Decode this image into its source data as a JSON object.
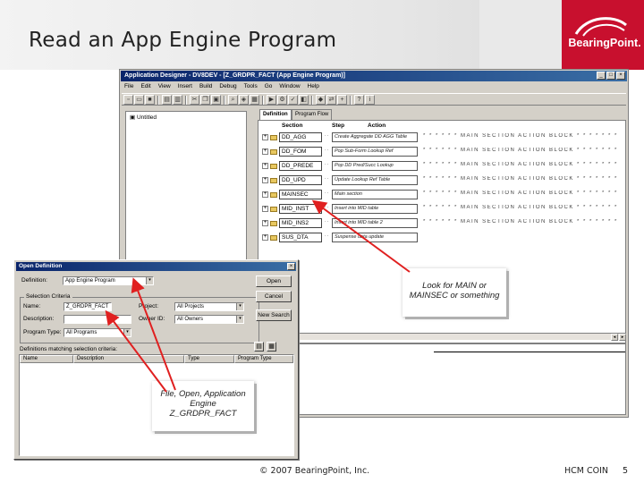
{
  "slide": {
    "title": "Read an App Engine Program",
    "logo_text": "BearingPoint.",
    "footer": {
      "copyright": "© 2007 BearingPoint, Inc.",
      "org": "HCM COIN",
      "page": "5"
    }
  },
  "app_window": {
    "title": "Application Designer - DV8DEV - [Z_GRDPR_FACT (App Engine Program)]",
    "menu": [
      "File",
      "Edit",
      "View",
      "Insert",
      "Build",
      "Debug",
      "Tools",
      "Go",
      "Window",
      "Help"
    ],
    "project_item": "Untitled",
    "tabs": [
      "Definition",
      "Program Flow"
    ],
    "columns": {
      "section": "Section",
      "step": "Step",
      "action": "Action"
    },
    "sections": [
      {
        "name": "DD_AGG",
        "desc": "Create Aggregate DD AGG Table"
      },
      {
        "name": "DD_FOM",
        "desc": "Pop Sub-Form Lookup Ref"
      },
      {
        "name": "DD_PREDE",
        "desc": "Pop DD Pred/Succ Lookup"
      },
      {
        "name": "DD_UPD",
        "desc": "Update Lookup Ref Table"
      },
      {
        "name": "MAINSEC",
        "desc": "Main section"
      },
      {
        "name": "MID_INST",
        "desc": "Insert into MID table"
      },
      {
        "name": "MID_INS2",
        "desc": "Insert into MID table 2"
      },
      {
        "name": "SUS_DTA",
        "desc": "Suspense data update"
      }
    ],
    "trail_text": "* * * * * * MAIN SECTION ACTION BLOCK * * * * * * * * *"
  },
  "callouts": {
    "main": "Look for MAIN or MAINSEC or something",
    "open_lines": [
      "File, Open, Application",
      "Engine",
      "Z_GRDPR_FACT"
    ]
  },
  "dialog": {
    "title": "Open Definition",
    "definition_label": "Definition:",
    "definition_value": "App Engine Program",
    "criteria_title": "Selection Criteria",
    "name_label": "Name:",
    "name_value": "Z_GRDPR_FACT",
    "description_label": "Description:",
    "type_label": "Program Type:",
    "type_value": "All Programs",
    "project_label": "Project:",
    "project_value": "All Projects",
    "owner_label": "Owner ID:",
    "owner_value": "All Owners",
    "buttons": {
      "open": "Open",
      "cancel": "Cancel",
      "new_search": "New Search"
    },
    "results_label": "Definitions matching selection criteria:",
    "results_columns": [
      "Name",
      "Description",
      "Type",
      "Program Type"
    ]
  },
  "colors": {
    "brand_red": "#c8102e",
    "arrow_red": "#e02020",
    "titlebar": "#0a246a"
  }
}
